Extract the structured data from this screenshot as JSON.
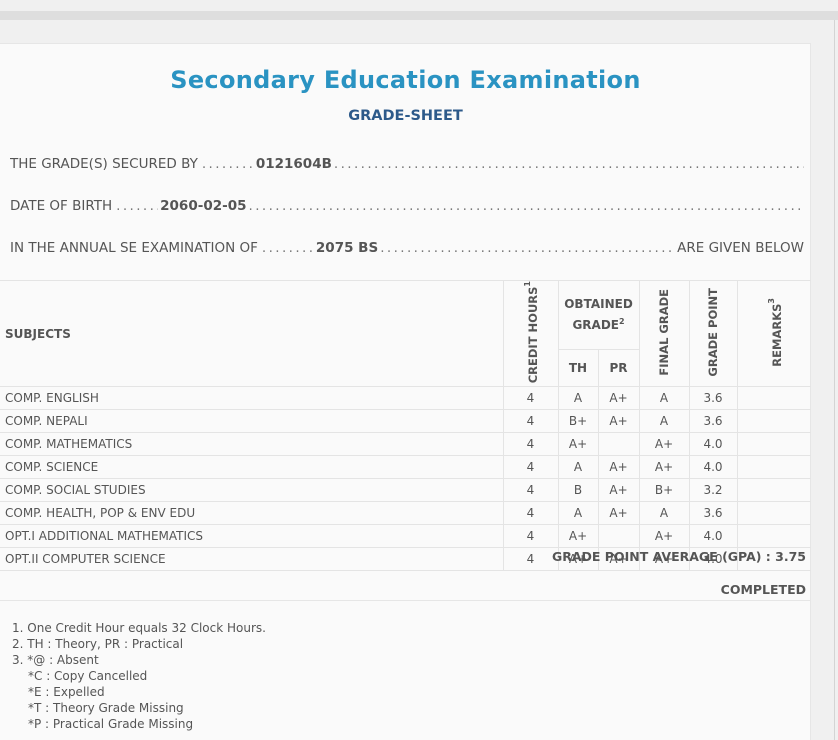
{
  "exam": {
    "title": "Secondary Education Examination",
    "subtitle": "GRADE-SHEET"
  },
  "info": {
    "secured_by_label": "THE GRADE(S) SECURED BY",
    "symbol_no": "0121604B",
    "dob_label": "DATE OF BIRTH",
    "dob": "2060-02-05",
    "exam_label": "IN THE ANNUAL SE EXAMINATION OF",
    "exam_year": "2075 BS",
    "given_below": "ARE GIVEN BELOW"
  },
  "table": {
    "headers": {
      "subjects": "SUBJECTS",
      "credit_hours": "CREDIT HOURS",
      "credit_sup": "1",
      "obtained_grade": "OBTAINED GRADE",
      "obtained_sup": "2",
      "th": "TH",
      "pr": "PR",
      "final_grade": "FINAL GRADE",
      "grade_point": "GRADE POINT",
      "remarks": "REMARKS",
      "remarks_sup": "3"
    },
    "rows": [
      {
        "subject": "COMP. ENGLISH",
        "credit": "4",
        "th": "A",
        "pr": "A+",
        "final": "A",
        "gp": "3.6",
        "remarks": ""
      },
      {
        "subject": "COMP. NEPALI",
        "credit": "4",
        "th": "B+",
        "pr": "A+",
        "final": "A",
        "gp": "3.6",
        "remarks": ""
      },
      {
        "subject": "COMP. MATHEMATICS",
        "credit": "4",
        "th": "A+",
        "pr": "",
        "final": "A+",
        "gp": "4.0",
        "remarks": ""
      },
      {
        "subject": "COMP. SCIENCE",
        "credit": "4",
        "th": "A",
        "pr": "A+",
        "final": "A+",
        "gp": "4.0",
        "remarks": ""
      },
      {
        "subject": "COMP. SOCIAL STUDIES",
        "credit": "4",
        "th": "B",
        "pr": "A+",
        "final": "B+",
        "gp": "3.2",
        "remarks": ""
      },
      {
        "subject": "COMP. HEALTH, POP & ENV EDU",
        "credit": "4",
        "th": "A",
        "pr": "A+",
        "final": "A",
        "gp": "3.6",
        "remarks": ""
      },
      {
        "subject": "OPT.I ADDITIONAL MATHEMATICS",
        "credit": "4",
        "th": "A+",
        "pr": "",
        "final": "A+",
        "gp": "4.0",
        "remarks": ""
      },
      {
        "subject": "OPT.II COMPUTER SCIENCE",
        "credit": "4",
        "th": "A+",
        "pr": "A+",
        "final": "A+",
        "gp": "4.0",
        "remarks": ""
      }
    ]
  },
  "summary": {
    "gpa_text": "GRADE POINT AVERAGE (GPA) : 3.75",
    "status": "COMPLETED"
  },
  "notes": [
    "1. One Credit Hour equals 32 Clock Hours.",
    "2. TH : Theory, PR : Practical",
    "3. *@ : Absent",
    "*C : Copy Cancelled",
    "*E : Expelled",
    "*T : Theory Grade Missing",
    "*P : Practical Grade Missing"
  ],
  "colors": {
    "title": "#2a93c2",
    "subtitle": "#2d5a8a"
  }
}
